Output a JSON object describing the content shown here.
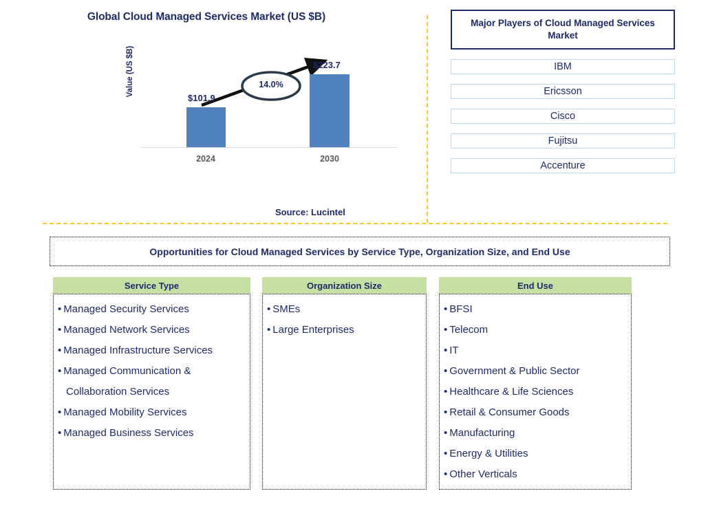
{
  "chart_panel": {
    "title": "Global Cloud Managed Services Market (US $B)",
    "y_axis_label": "Value (US $B)",
    "source": "Source: Lucintel"
  },
  "chart_data": {
    "type": "bar",
    "title": "Global Cloud Managed Services Market (US $B)",
    "categories": [
      "2024",
      "2030"
    ],
    "values": [
      101.9,
      223.7
    ],
    "value_labels": [
      "$101.9",
      "$223.7"
    ],
    "xlabel": "",
    "ylabel": "Value (US $B)",
    "ylim": [
      0,
      240
    ],
    "grid": false,
    "legend": "none",
    "bar_color": "#4F81BD",
    "annotations": [
      {
        "text": "14.0%",
        "kind": "cagr-callout",
        "from": "2024",
        "to": "2030"
      }
    ]
  },
  "players_panel": {
    "header": "Major Players of Cloud Managed Services Market",
    "items": [
      {
        "label": "IBM"
      },
      {
        "label": "Ericsson"
      },
      {
        "label": "Cisco"
      },
      {
        "label": "Fujitsu"
      },
      {
        "label": "Accenture"
      }
    ]
  },
  "banner": {
    "title": "Opportunities for Cloud Managed Services by Service Type, Organization Size, and End Use"
  },
  "columns": [
    {
      "header": "Service Type",
      "items": [
        {
          "text": "Managed Security Services",
          "cont": ""
        },
        {
          "text": "Managed Network Services",
          "cont": ""
        },
        {
          "text": "Managed Infrastructure Services",
          "cont": ""
        },
        {
          "text": "Managed Communication &",
          "cont": "Collaboration Services"
        },
        {
          "text": "Managed Mobility Services",
          "cont": ""
        },
        {
          "text": "Managed Business Services",
          "cont": ""
        }
      ]
    },
    {
      "header": "Organization Size",
      "items": [
        {
          "text": "SMEs",
          "cont": ""
        },
        {
          "text": "Large Enterprises",
          "cont": ""
        }
      ]
    },
    {
      "header": "End Use",
      "items": [
        {
          "text": "BFSI",
          "cont": ""
        },
        {
          "text": "Telecom",
          "cont": ""
        },
        {
          "text": "IT",
          "cont": ""
        },
        {
          "text": "Government & Public Sector",
          "cont": ""
        },
        {
          "text": "Healthcare & Life Sciences",
          "cont": ""
        },
        {
          "text": "Retail & Consumer Goods",
          "cont": ""
        },
        {
          "text": "Manufacturing",
          "cont": ""
        },
        {
          "text": "Energy & Utilities",
          "cont": ""
        },
        {
          "text": "Other Verticals",
          "cont": ""
        }
      ]
    }
  ],
  "bullet_glyph": "•",
  "colors": {
    "navy": "#1F2A68",
    "bar_blue": "#4F81BD",
    "header_green": "#C6E0A4",
    "divider_orange": "#FFC425",
    "tick_gray": "#5A5A5A"
  }
}
